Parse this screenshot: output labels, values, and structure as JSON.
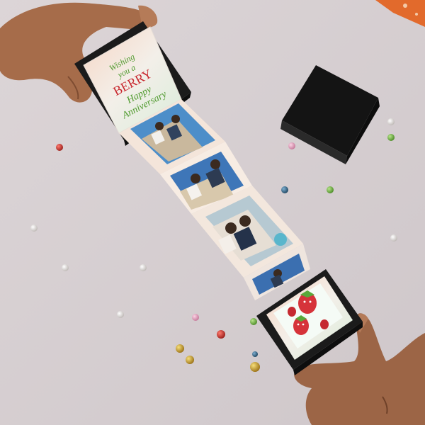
{
  "photo": {
    "background_color": "#d9d2d4",
    "greeting_card": {
      "line1": "Wishing",
      "line2": "you a",
      "line3": "BERRY",
      "line4": "Happy",
      "line5": "Anniversary",
      "green": "#4f9a2e",
      "red": "#c8262d"
    },
    "box_color": "#1c1c1c",
    "bead_colors": [
      "#c9362f",
      "#e9e6e3",
      "#c9a227",
      "#3a6f8f",
      "#7ab54a",
      "#e3a6c1"
    ]
  }
}
